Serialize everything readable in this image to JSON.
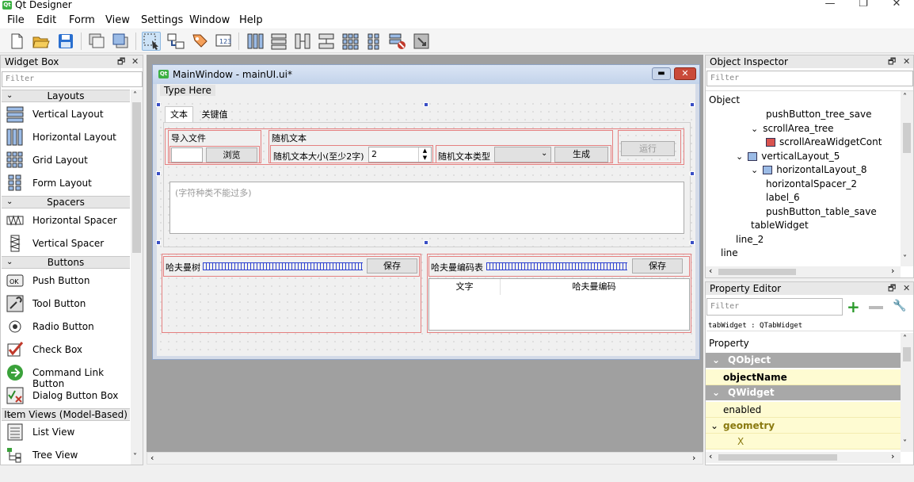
{
  "app": {
    "title": "Qt Designer",
    "icon": "qt-designer-icon"
  },
  "menu": [
    "File",
    "Edit",
    "Form",
    "View",
    "Settings",
    "Window",
    "Help"
  ],
  "widget_box": {
    "title": "Widget Box",
    "filter_placeholder": "Filter",
    "categories": [
      {
        "label": "Layouts",
        "items": [
          "Vertical Layout",
          "Horizontal Layout",
          "Grid Layout",
          "Form Layout"
        ]
      },
      {
        "label": "Spacers",
        "items": [
          "Horizontal Spacer",
          "Vertical Spacer"
        ]
      },
      {
        "label": "Buttons",
        "items": [
          "Push Button",
          "Tool Button",
          "Radio Button",
          "Check Box",
          "Command Link Button",
          "Dialog Button Box"
        ]
      },
      {
        "label": "Item Views (Model-Based)",
        "items": [
          "List View",
          "Tree View"
        ]
      }
    ]
  },
  "form_window": {
    "title": "MainWindow - mainUI.ui*",
    "menu_placeholder": "Type Here",
    "tabs": [
      "文本",
      "关键值"
    ],
    "import_group": "导入文件",
    "browse_btn": "浏览",
    "random_group": "随机文本",
    "random_size_label": "随机文本大小(至少2字)",
    "random_size_value": "2",
    "random_type_label": "随机文本类型",
    "generate_btn": "生成",
    "run_btn": "运行",
    "text_placeholder": "(字符种类不能过多)",
    "huffman_tree_label": "哈夫曼树",
    "save_btn_1": "保存",
    "huffman_table_label": "哈夫曼编码表",
    "save_btn_2": "保存",
    "table_headers": [
      "文字",
      "哈夫曼编码"
    ]
  },
  "object_inspector": {
    "title": "Object Inspector",
    "filter_placeholder": "Filter",
    "header": "Object",
    "rows": [
      {
        "text": "pushButton_tree_save",
        "indent": 4,
        "arrow": "",
        "icon": ""
      },
      {
        "text": "scrollArea_tree",
        "indent": 3,
        "arrow": "v",
        "icon": ""
      },
      {
        "text": "scrollAreaWidgetCont",
        "indent": 4,
        "arrow": "",
        "icon": "widget-icon"
      },
      {
        "text": "verticalLayout_5",
        "indent": 2,
        "arrow": "v",
        "icon": "vlayout-icon"
      },
      {
        "text": "horizontalLayout_8",
        "indent": 3,
        "arrow": "v",
        "icon": "hlayout-icon"
      },
      {
        "text": "horizontalSpacer_2",
        "indent": 4,
        "arrow": "",
        "icon": ""
      },
      {
        "text": "label_6",
        "indent": 4,
        "arrow": "",
        "icon": ""
      },
      {
        "text": "pushButton_table_save",
        "indent": 4,
        "arrow": "",
        "icon": ""
      },
      {
        "text": "tableWidget",
        "indent": 3,
        "arrow": "",
        "icon": ""
      },
      {
        "text": "line_2",
        "indent": 2,
        "arrow": "",
        "icon": ""
      },
      {
        "text": "line",
        "indent": 1,
        "arrow": "",
        "icon": ""
      }
    ]
  },
  "property_editor": {
    "title": "Property Editor",
    "filter_placeholder": "Filter",
    "class_line": "tabWidget : QTabWidget",
    "header": "Property",
    "rows": [
      {
        "type": "cat",
        "text": "QObject"
      },
      {
        "type": "prop",
        "text": "objectName",
        "bold": true
      },
      {
        "type": "cat",
        "text": "QWidget"
      },
      {
        "type": "prop",
        "text": "enabled"
      },
      {
        "type": "group",
        "text": "geometry"
      },
      {
        "type": "sub",
        "text": "X"
      }
    ]
  },
  "colors": {
    "accent": "#3a4fc4",
    "layout_border": "#e58080",
    "prop_yellow": "#fefbd2",
    "prop_category": "#a8a8a8"
  }
}
